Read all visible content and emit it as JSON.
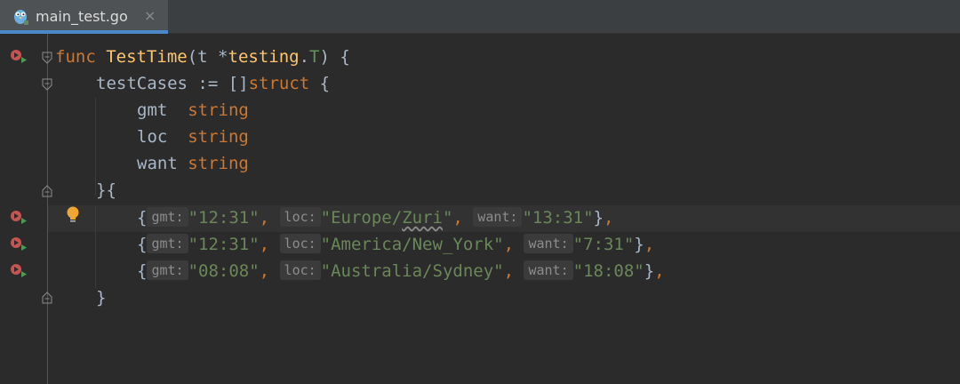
{
  "tab": {
    "filename": "main_test.go",
    "close_glyph": "×",
    "icon": "gopher-icon"
  },
  "code": {
    "l1": {
      "kw": "func",
      "name": "TestTime",
      "open": "(t *",
      "pkg": "testing",
      "dot": ".",
      "typ": "T",
      "close": ") {"
    },
    "l2": {
      "ident": "testCases",
      "op": " := []",
      "kw": "struct",
      "brace": " {"
    },
    "fields": [
      {
        "name": "gmt",
        "pad": "  ",
        "type": "string"
      },
      {
        "name": "loc",
        "pad": "  ",
        "type": "string"
      },
      {
        "name": "want",
        "pad": " ",
        "type": "string"
      }
    ],
    "l6": "}{",
    "rows": [
      {
        "gmt": "\"12:31\"",
        "loc_pre": "\"Europe/",
        "loc_typo": "Zuri",
        "loc_post": "\"",
        "want": "\"13:31\""
      },
      {
        "gmt": "\"12:31\"",
        "loc_pre": "\"America/New_York\"",
        "loc_typo": "",
        "loc_post": "",
        "want": "\"7:31\""
      },
      {
        "gmt": "\"08:08\"",
        "loc_pre": "\"Australia/Sydney\"",
        "loc_typo": "",
        "loc_post": "",
        "want": "\"18:08\""
      }
    ],
    "hints": {
      "gmt": "gmt:",
      "loc": "loc:",
      "want": "want:"
    },
    "close_brace": "}"
  },
  "colors": {
    "background": "#2b2b2b",
    "keyword": "#cc7832",
    "function": "#ffc66d",
    "string": "#6a8759",
    "text": "#a9b7c6",
    "run_icon": "#c75450"
  }
}
